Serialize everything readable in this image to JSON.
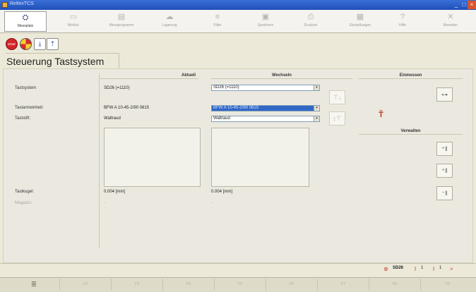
{
  "window": {
    "title": "ReflexTCS"
  },
  "toolbar": {
    "buttons": [
      {
        "label": "Messplatz",
        "icon": "robot-icon"
      },
      {
        "label": "Werkst.",
        "icon": "folder-icon"
      },
      {
        "label": "Messprogramm",
        "icon": "program-icon"
      },
      {
        "label": "Lagerung",
        "icon": "cloud-icon"
      },
      {
        "label": "Filter",
        "icon": "filter-icon"
      },
      {
        "label": "Speichern",
        "icon": "save-icon"
      },
      {
        "label": "Drucken",
        "icon": "print-icon"
      },
      {
        "label": "Einstellungen",
        "icon": "grid-icon"
      },
      {
        "label": "Hilfe",
        "icon": "help-icon"
      },
      {
        "label": "Beenden",
        "icon": "close-icon"
      }
    ]
  },
  "page": {
    "title": "Steuerung Tastsystem"
  },
  "columns": {
    "aktuell": "Aktuell",
    "wechseln": "Wechseln",
    "einmessen": "Einmessen",
    "verwalten": "Verwalten"
  },
  "rows": {
    "tastsystem": {
      "label": "Tastsystem",
      "value": "SD26 (=1110)",
      "select": "SD26 (=1110)"
    },
    "tastarmeinheit": {
      "label": "Tastarmeinheit:",
      "value": "BFW A 10-45-2/90 0815",
      "select": "BFW A 10-45-2/90 0815"
    },
    "taststift": {
      "label": "Taststift:",
      "value": "Waltraud",
      "select": "Waltraud"
    },
    "tastkugel": {
      "label": "Tastkugel:",
      "value": "0.004 [mm]",
      "value2": "0.004 [mm]"
    },
    "magazin": {
      "label": "Magazin:",
      "value": "-",
      "value2": "-"
    }
  },
  "status": {
    "system": "SD26",
    "count_a": "1",
    "count_b": "1",
    "close": "×"
  },
  "fkeys": [
    "≣",
    "F2",
    "F3",
    "F4",
    "F5",
    "F6",
    "F7",
    "F8",
    "F9"
  ]
}
